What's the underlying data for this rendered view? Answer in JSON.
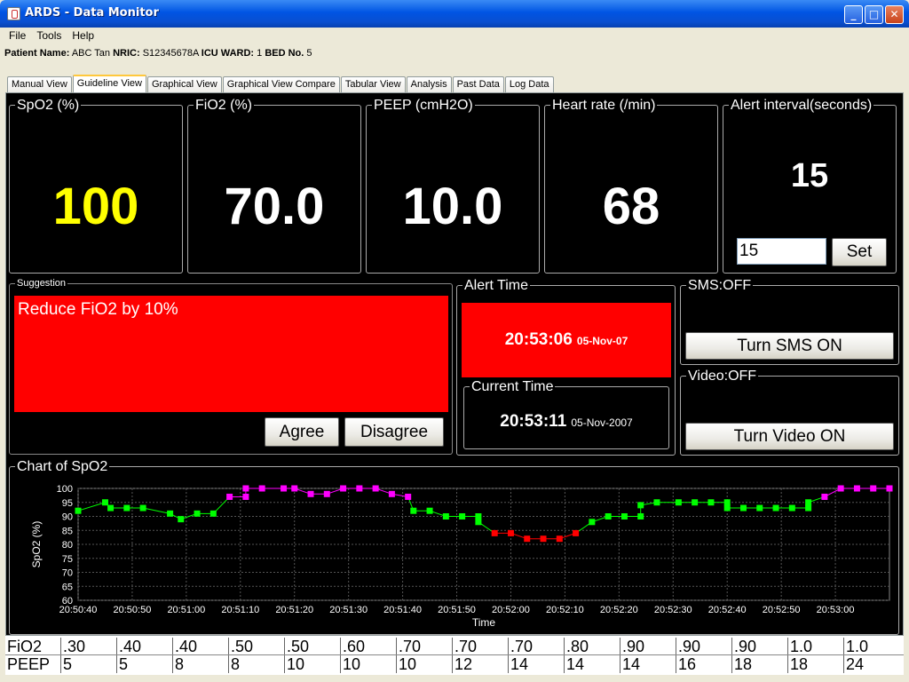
{
  "window": {
    "title": "ARDS - Data Monitor"
  },
  "menu": [
    "File",
    "Tools",
    "Help"
  ],
  "patient": {
    "name_label": "Patient Name:",
    "name": "ABC Tan",
    "nric_label": "NRIC:",
    "nric": "S12345678A",
    "ward_label": "ICU WARD:",
    "ward": "1",
    "bed_label": "BED No.",
    "bed": "5"
  },
  "tabs": [
    "Manual View",
    "Guideline View",
    "Graphical View",
    "Graphical View Compare",
    "Tabular View",
    "Analysis",
    "Past Data",
    "Log Data"
  ],
  "active_tab": "Guideline View",
  "vitals": [
    {
      "label": "SpO2 (%)",
      "value": "100",
      "color": "#FFFF00"
    },
    {
      "label": "FiO2 (%)",
      "value": "70.0",
      "color": "#FFFFFF"
    },
    {
      "label": "PEEP (cmH2O)",
      "value": "10.0",
      "color": "#FFFFFF"
    },
    {
      "label": "Heart rate (/min)",
      "value": "68",
      "color": "#FFFFFF"
    }
  ],
  "alert_interval": {
    "label": "Alert interval(seconds)",
    "value": "15",
    "input_value": "15",
    "set_label": "Set"
  },
  "suggestion": {
    "label": "Suggestion",
    "text": "Reduce FiO2 by 10%",
    "agree": "Agree",
    "disagree": "Disagree"
  },
  "alert_time": {
    "label": "Alert Time",
    "time": "20:53:06",
    "date": "05-Nov-07"
  },
  "current_time": {
    "label": "Current Time",
    "time": "20:53:11",
    "date": "05-Nov-2007"
  },
  "sms": {
    "label": "SMS:OFF",
    "button": "Turn SMS ON"
  },
  "video": {
    "label": "Video:OFF",
    "button": "Turn Video ON"
  },
  "colors": {
    "alert_red": "#FF0000",
    "ok_green": "#00FF00",
    "high_magenta": "#FF00FF",
    "low_red": "#FF0000"
  },
  "chart_data": {
    "type": "line",
    "title": "Chart of SpO2",
    "xlabel": "Time",
    "ylabel": "SpO2 (%)",
    "ylim": [
      60,
      100
    ],
    "yticks": [
      60,
      65,
      70,
      75,
      80,
      85,
      90,
      95,
      100
    ],
    "xlim": [
      "20:50:40",
      "20:53:10"
    ],
    "xticks": [
      "20:50:40",
      "20:50:50",
      "20:51:00",
      "20:51:10",
      "20:51:20",
      "20:51:30",
      "20:51:40",
      "20:51:50",
      "20:52:00",
      "20:52:10",
      "20:52:20",
      "20:52:30",
      "20:52:40",
      "20:52:50",
      "20:53:00"
    ],
    "grid": true,
    "series": [
      {
        "points": [
          [
            "20:50:40",
            92
          ],
          [
            "20:50:45",
            95
          ],
          [
            "20:50:46",
            93
          ],
          [
            "20:50:49",
            93
          ],
          [
            "20:50:52",
            93
          ],
          [
            "20:50:57",
            91
          ],
          [
            "20:50:59",
            89
          ],
          [
            "20:51:02",
            91
          ],
          [
            "20:51:05",
            91
          ],
          [
            "20:51:08",
            97
          ],
          [
            "20:51:11",
            97
          ],
          [
            "20:51:11",
            100
          ],
          [
            "20:51:14",
            100
          ],
          [
            "20:51:18",
            100
          ],
          [
            "20:51:20",
            100
          ],
          [
            "20:51:23",
            98
          ],
          [
            "20:51:26",
            98
          ],
          [
            "20:51:29",
            100
          ],
          [
            "20:51:32",
            100
          ],
          [
            "20:51:35",
            100
          ],
          [
            "20:51:38",
            98
          ],
          [
            "20:51:41",
            97
          ],
          [
            "20:51:42",
            92
          ],
          [
            "20:51:45",
            92
          ],
          [
            "20:51:48",
            90
          ],
          [
            "20:51:51",
            90
          ],
          [
            "20:51:54",
            90
          ],
          [
            "20:51:54",
            88
          ],
          [
            "20:51:57",
            84
          ],
          [
            "20:52:00",
            84
          ],
          [
            "20:52:03",
            82
          ],
          [
            "20:52:06",
            82
          ],
          [
            "20:52:09",
            82
          ],
          [
            "20:52:12",
            84
          ],
          [
            "20:52:15",
            88
          ],
          [
            "20:52:18",
            90
          ],
          [
            "20:52:21",
            90
          ],
          [
            "20:52:24",
            90
          ],
          [
            "20:52:24",
            94
          ],
          [
            "20:52:27",
            95
          ],
          [
            "20:52:31",
            95
          ],
          [
            "20:52:34",
            95
          ],
          [
            "20:52:37",
            95
          ],
          [
            "20:52:40",
            95
          ],
          [
            "20:52:40",
            93
          ],
          [
            "20:52:43",
            93
          ],
          [
            "20:52:46",
            93
          ],
          [
            "20:52:49",
            93
          ],
          [
            "20:52:52",
            93
          ],
          [
            "20:52:55",
            93
          ],
          [
            "20:52:55",
            95
          ],
          [
            "20:52:58",
            97
          ],
          [
            "20:53:01",
            100
          ],
          [
            "20:53:04",
            100
          ],
          [
            "20:53:07",
            100
          ],
          [
            "20:53:10",
            100
          ]
        ]
      }
    ]
  },
  "settings_table": {
    "rows": [
      {
        "label": "FiO2",
        "values": [
          ".30",
          ".40",
          ".40",
          ".50",
          ".50",
          ".60",
          ".70",
          ".70",
          ".70",
          ".80",
          ".90",
          ".90",
          ".90",
          "1.0",
          "1.0"
        ]
      },
      {
        "label": "PEEP",
        "values": [
          "5",
          "5",
          "8",
          "8",
          "10",
          "10",
          "10",
          "12",
          "14",
          "14",
          "14",
          "16",
          "18",
          "18",
          "24"
        ]
      }
    ]
  }
}
